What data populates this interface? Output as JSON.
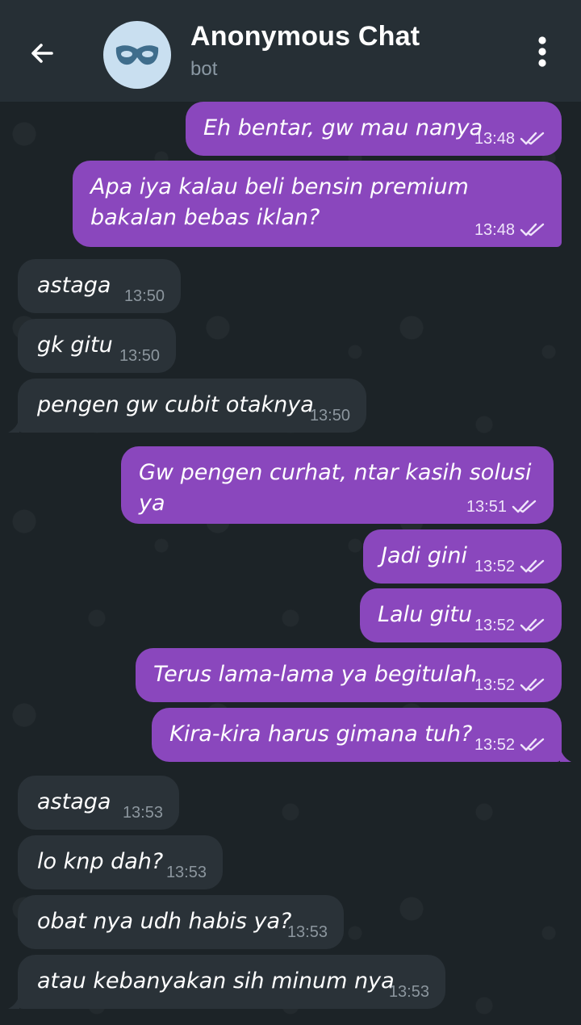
{
  "header": {
    "title": "Anonymous Chat",
    "subtitle": "bot"
  },
  "colors": {
    "header_bg": "#262f35",
    "chat_bg": "#1c2327",
    "outgoing_bubble": "#8a47bd",
    "incoming_bubble": "#2a3238",
    "avatar_bg": "#c9dff0"
  },
  "icons": {
    "back": "arrow-left-icon",
    "avatar": "mask-icon",
    "menu": "more-vertical-icon",
    "read": "double-check-icon"
  },
  "messages": [
    {
      "dir": "out",
      "text": "Eh bentar, gw mau nanya",
      "time": "13:48",
      "read": true
    },
    {
      "dir": "out",
      "text": "Apa iya kalau beli bensin premium bakalan bebas iklan?",
      "time": "13:48",
      "read": true
    },
    {
      "dir": "in",
      "text": "astaga",
      "time": "13:50"
    },
    {
      "dir": "in",
      "text": "gk gitu",
      "time": "13:50"
    },
    {
      "dir": "in",
      "text": "pengen gw cubit otaknya",
      "time": "13:50"
    },
    {
      "dir": "out",
      "text": "Gw pengen curhat, ntar kasih solusi ya",
      "time": "13:51",
      "read": true
    },
    {
      "dir": "out",
      "text": "Jadi gini",
      "time": "13:52",
      "read": true
    },
    {
      "dir": "out",
      "text": "Lalu gitu",
      "time": "13:52",
      "read": true
    },
    {
      "dir": "out",
      "text": "Terus lama-lama ya begitulah",
      "time": "13:52",
      "read": true
    },
    {
      "dir": "out",
      "text": "Kira-kira harus gimana tuh?",
      "time": "13:52",
      "read": true
    },
    {
      "dir": "in",
      "text": "astaga",
      "time": "13:53"
    },
    {
      "dir": "in",
      "text": "lo knp dah?",
      "time": "13:53"
    },
    {
      "dir": "in",
      "text": "obat nya udh habis ya?",
      "time": "13:53"
    },
    {
      "dir": "in",
      "text": "atau kebanyakan sih minum nya",
      "time": "13:53"
    }
  ]
}
